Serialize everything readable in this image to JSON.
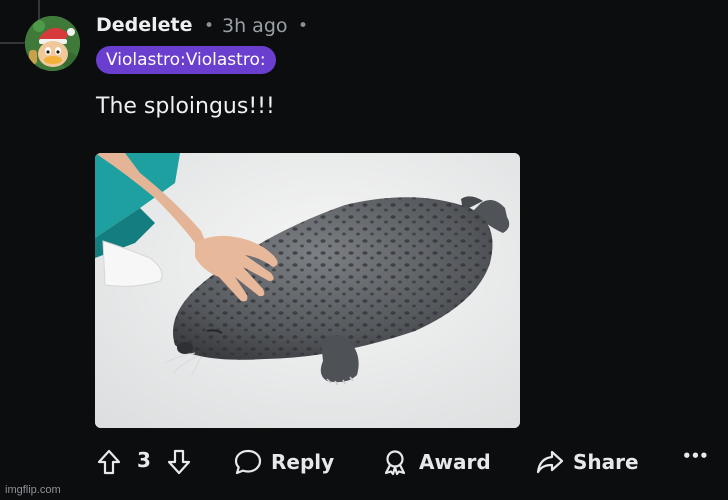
{
  "comment": {
    "username": "Dedelete",
    "separator": "•",
    "time_ago": "3h ago",
    "flair": "Violastro:Violastro:",
    "text": "The sploingus!!!",
    "image_alt": "Photo of a spotted seal lying on a white floor being petted by a hand"
  },
  "actions": {
    "upvote_icon": "arrow-up-outline-icon",
    "vote_count": "3",
    "downvote_icon": "arrow-down-outline-icon",
    "reply_label": "Reply",
    "award_label": "Award",
    "share_label": "Share",
    "more_label": "•••"
  },
  "watermark": "imgflip.com",
  "colors": {
    "background": "#0b0d0f",
    "flair_bg": "#6a3ecf",
    "text": "#e8eaec",
    "muted": "#9aa0a6"
  }
}
